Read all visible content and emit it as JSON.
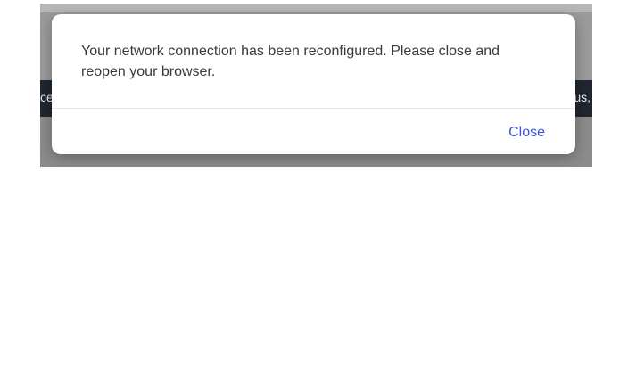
{
  "background": {
    "left_fragment": "ce",
    "right_fragment": "us,",
    "colors": {
      "overlay_gray": "#9a9a9a",
      "dark_strip": "#1f2630",
      "strip_text": "#e8eef6"
    }
  },
  "dialog": {
    "message": "Your network connection has been reconfigured. Please close and reopen your browser.",
    "close_label": "Close",
    "colors": {
      "text": "#3a3a3a",
      "button_text": "#3b56d9",
      "surface": "#ffffff"
    }
  }
}
